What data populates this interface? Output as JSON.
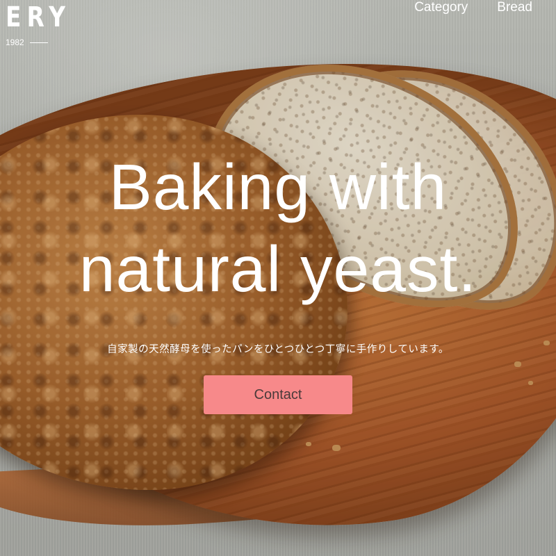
{
  "brand": {
    "wordmark": "ERY",
    "since": "1982"
  },
  "nav": {
    "items": [
      {
        "label": "Category"
      },
      {
        "label": "Bread"
      }
    ]
  },
  "hero": {
    "headline_line1": "Baking with",
    "headline_line2": "natural yeast.",
    "subtitle": "自家製の天然酵母を使ったパンをひとつひとつ丁寧に手作りしています。",
    "cta_label": "Contact"
  },
  "colors": {
    "cta_background": "#f7898a",
    "cta_text": "#4a3a3a",
    "text": "#ffffff"
  }
}
